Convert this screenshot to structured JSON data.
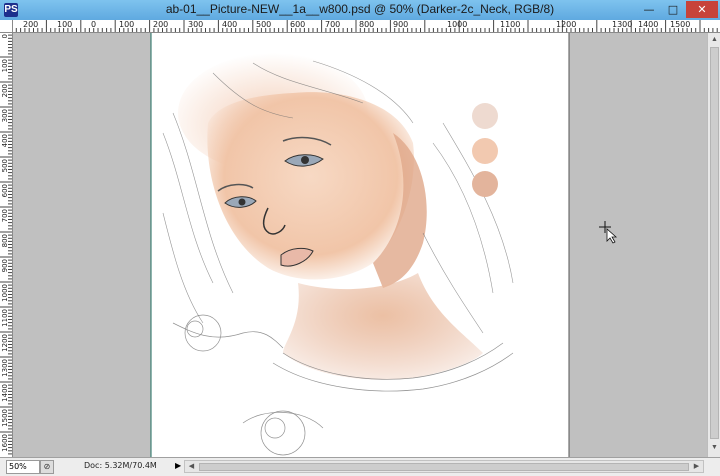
{
  "window": {
    "app_icon": "PS",
    "title": "ab-01__Picture-NEW__1a__w800.psd @ 50% (Darker-2c_Neck, RGB/8)",
    "controls": {
      "minimize": "—",
      "maximize": "□",
      "close": "✕"
    }
  },
  "ruler": {
    "horizontal": [
      "200",
      "100",
      "0",
      "100",
      "200",
      "300",
      "400",
      "500",
      "600",
      "700",
      "800",
      "900",
      "1000",
      "1100",
      "1200",
      "1300",
      "1400",
      "1500"
    ],
    "vertical": [
      "0",
      "100",
      "200",
      "300",
      "400",
      "500",
      "600",
      "700",
      "800",
      "900",
      "1000",
      "1100",
      "1200",
      "1300",
      "1400",
      "1500",
      "1600"
    ]
  },
  "document": {
    "swatches": [
      {
        "name": "light-skin",
        "color": "#eedad0"
      },
      {
        "name": "mid-skin",
        "color": "#f2c9b0"
      },
      {
        "name": "dark-skin",
        "color": "#e3b49c"
      }
    ],
    "canvas_color": "#ffffff",
    "pasteboard_color": "#c0c0c0"
  },
  "cursor": "crosshair-icon",
  "status": {
    "zoom": "50%",
    "doc_info": "Doc: 5.32M/70.4M",
    "menu_arrow": "▶"
  },
  "scrollbars": {
    "up": "▲",
    "down": "▼",
    "left": "◀",
    "right": "▶"
  }
}
